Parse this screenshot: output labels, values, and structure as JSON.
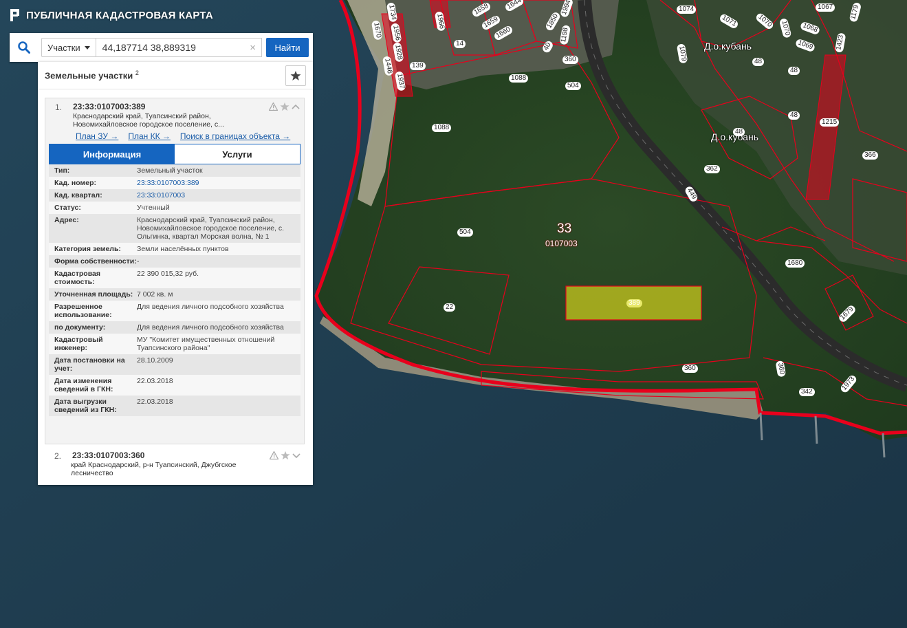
{
  "app": {
    "title": "ПУБЛИЧНАЯ КАДАСТРОВАЯ КАРТА"
  },
  "search": {
    "type": "Участки",
    "query": "44,187714 38,889319",
    "clear": "×",
    "button": "Найти"
  },
  "panel": {
    "heading": "Земельные участки",
    "count": "2",
    "results": [
      {
        "num": "1.",
        "cad_number": "23:33:0107003:389",
        "address_short": "Краснодарский край, Туапсинский район, Новомихайловское городское поселение, с...",
        "links": [
          "План ЗУ →",
          "План КК →",
          "Поиск в границах объекта →"
        ],
        "tabs": [
          "Информация",
          "Услуги"
        ],
        "info": [
          {
            "k": "Тип:",
            "v": "Земельный участок"
          },
          {
            "k": "Кад. номер:",
            "v": "23:33:0107003:389"
          },
          {
            "k": "Кад. квартал:",
            "v": "23:33:0107003"
          },
          {
            "k": "Статус:",
            "v": "Учтенный"
          },
          {
            "k": "Адрес:",
            "v": "Краснодарский край, Туапсинский район, Новомихайловское городское поселение, с. Ольгинка, квартал Морская волна, № 1"
          },
          {
            "k": "Категория земель:",
            "v": "Земли населённых пунктов"
          },
          {
            "k": "Форма собственности:",
            "v": "-"
          },
          {
            "k": "Кадастровая стоимость:",
            "v": "22 390 015,32 руб."
          },
          {
            "k": "Уточненная площадь:",
            "v": "7 002 кв. м"
          },
          {
            "k": "Разрешенное использование:",
            "v": "Для ведения личного подсобного хозяйства"
          },
          {
            "k": "по документу:",
            "v": "Для ведения личного подсобного хозяйства"
          },
          {
            "k": "Кадастровый инженер:",
            "v": "МУ \"Комитет имущественных отношений Туапсинского района\""
          },
          {
            "k": "Дата постановки на учет:",
            "v": "28.10.2009"
          },
          {
            "k": "Дата изменения сведений в ГКН:",
            "v": "22.03.2018"
          },
          {
            "k": "Дата выгрузки сведений из ГКН:",
            "v": "22.03.2018"
          }
        ]
      },
      {
        "num": "2.",
        "cad_number": "23:33:0107003:360",
        "address_short": "край Краснодарский, р-н Туапсинский, Джубгское лесничество"
      }
    ]
  },
  "map": {
    "district": "33",
    "quarter": "0107003",
    "place_names": [
      "Д.о.кубань",
      "Д.о.кубань"
    ],
    "parcel_labels": [
      "1074",
      "1067",
      "1179",
      "1071",
      "1070",
      "1070",
      "1068",
      "1069",
      "1079",
      "1423",
      "1670",
      "1734",
      "1956",
      "1928",
      "1446",
      "1937",
      "1966",
      "1658",
      "1659",
      "1660",
      "1644",
      "1850",
      "1198",
      "1994",
      "14",
      "139",
      "360",
      "1088",
      "504",
      "1088",
      "48",
      "48",
      "48",
      "48",
      "362",
      "1215",
      "366",
      "449",
      "504",
      "22",
      "389",
      "1680",
      "1679",
      "360",
      "360",
      "342",
      "1973",
      "40"
    ],
    "colors": {
      "boundary": "#e8001c",
      "selected_fill": "#c8c81e",
      "accent": "#1565c0"
    }
  }
}
